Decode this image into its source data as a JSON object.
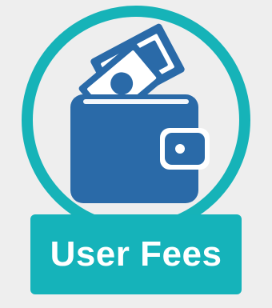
{
  "badge": {
    "label": "User Fees",
    "icon": "wallet-with-cash-icon",
    "colors": {
      "background": "#eeeeee",
      "ring": "#16b3b8",
      "label_bg": "#15b3ba",
      "icon": "#2a6aa8",
      "label_text": "#ffffff"
    }
  }
}
